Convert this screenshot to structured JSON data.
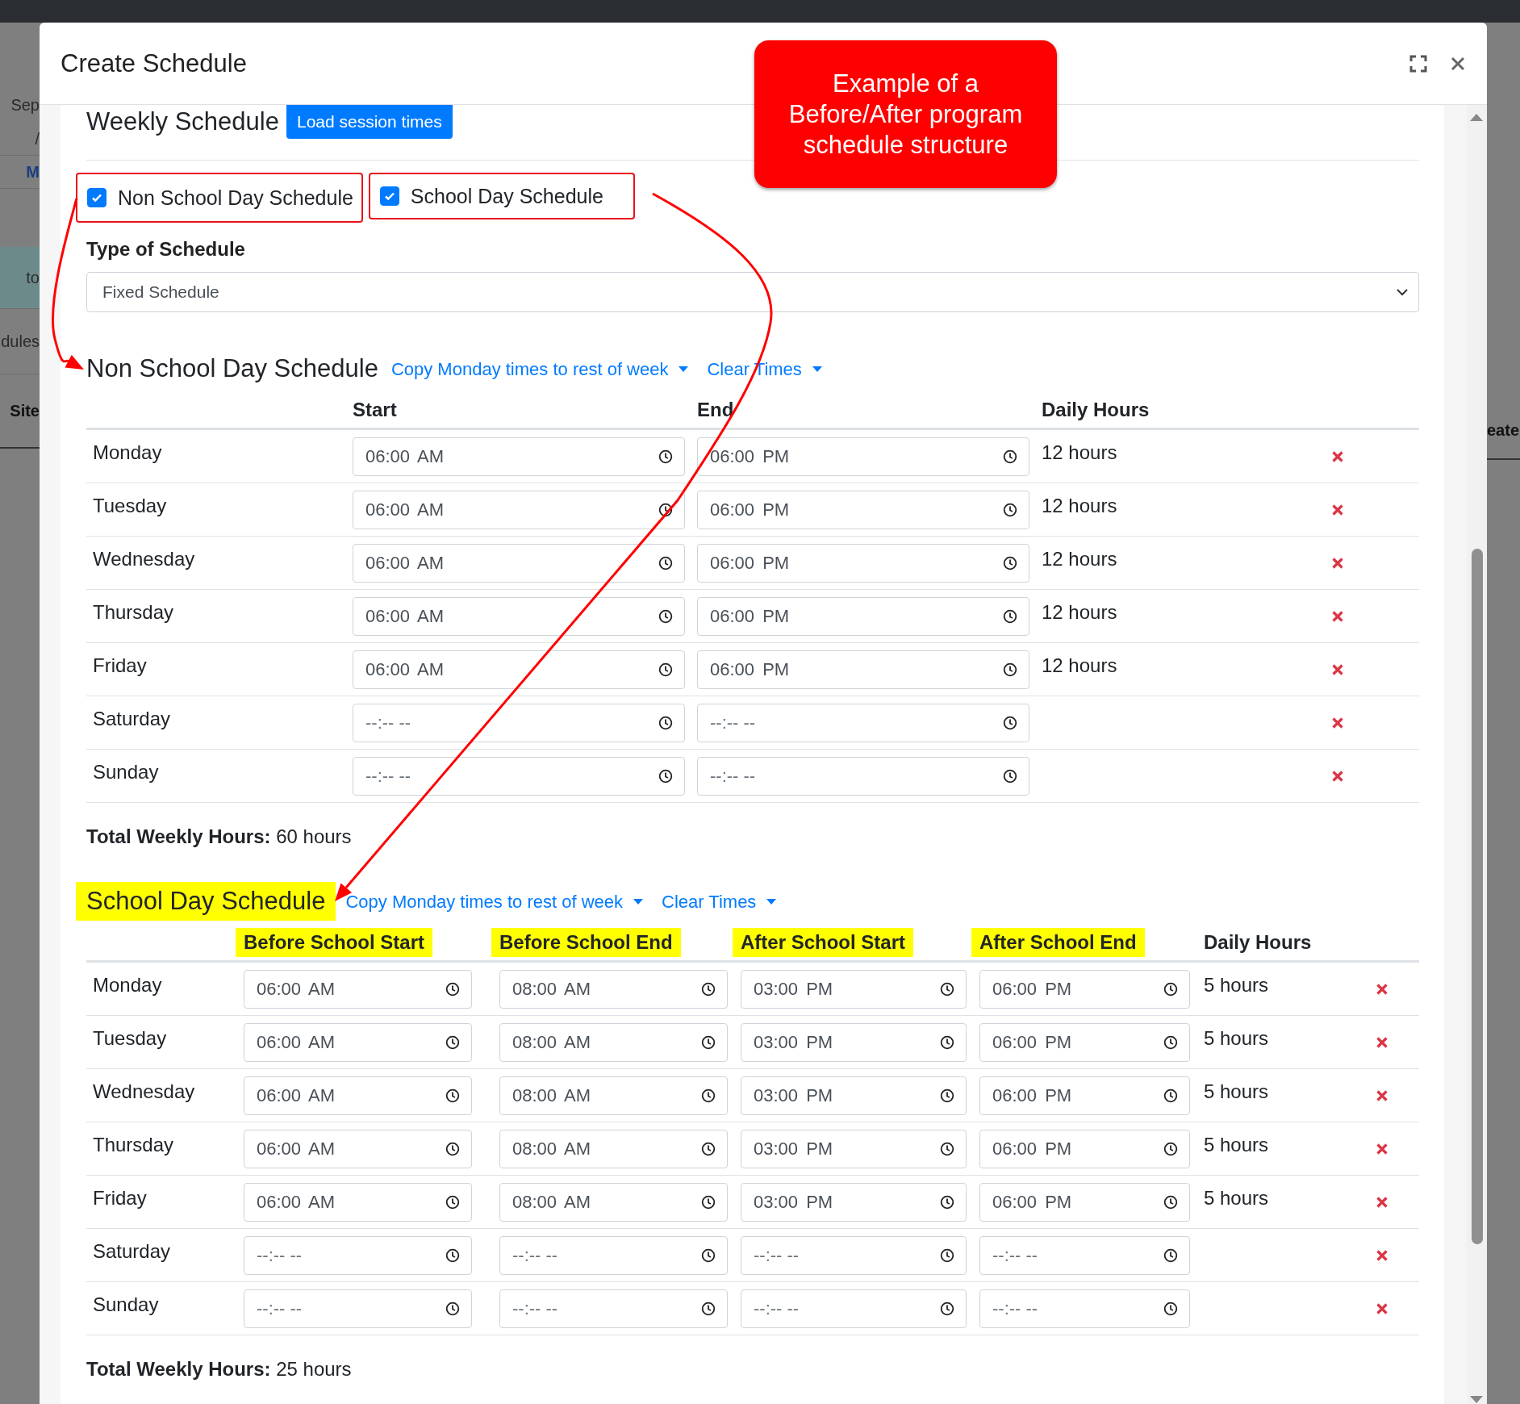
{
  "backdrop": {
    "left_texts": [
      {
        "text": "Sep",
        "kind": "plain"
      },
      {
        "text": "/",
        "kind": "plain"
      },
      {
        "text": "M",
        "kind": "link"
      },
      {
        "text": "to",
        "kind": "banner"
      },
      {
        "text": "dules",
        "kind": "plain"
      },
      {
        "text": "Site",
        "kind": "bold"
      }
    ],
    "right_texts": [
      {
        "text": "eate",
        "kind": "bold"
      }
    ]
  },
  "modal": {
    "title": "Create Schedule"
  },
  "callout": {
    "lines": [
      "Example of a",
      "Before/After program",
      "schedule structure"
    ]
  },
  "weekly": {
    "heading": "Weekly Schedule",
    "button": "Load session times"
  },
  "options": [
    {
      "label": "Non School Day Schedule",
      "checked": true,
      "outlined": true
    },
    {
      "label": "School Day Schedule",
      "checked": true,
      "outlined": true
    }
  ],
  "type_of_schedule": {
    "label": "Type of Schedule",
    "value": "Fixed Schedule"
  },
  "sections": [
    {
      "kind": "non_school",
      "title": "Non School Day Schedule",
      "highlighted": false,
      "actions": [
        "Copy Monday times to rest of week",
        "Clear Times"
      ],
      "columns": [
        {
          "label": "Start",
          "highlighted": false
        },
        {
          "label": "End",
          "highlighted": false
        },
        {
          "label": "Daily Hours",
          "highlighted": false
        }
      ],
      "rows": [
        {
          "day": "Monday",
          "times": [
            {
              "value": "06:00 AM"
            },
            {
              "value": "06:00 PM"
            }
          ],
          "daily_hours": "12 hours"
        },
        {
          "day": "Tuesday",
          "times": [
            {
              "value": "06:00 AM"
            },
            {
              "value": "06:00 PM"
            }
          ],
          "daily_hours": "12 hours"
        },
        {
          "day": "Wednesday",
          "times": [
            {
              "value": "06:00 AM"
            },
            {
              "value": "06:00 PM"
            }
          ],
          "daily_hours": "12 hours"
        },
        {
          "day": "Thursday",
          "times": [
            {
              "value": "06:00 AM"
            },
            {
              "value": "06:00 PM"
            }
          ],
          "daily_hours": "12 hours"
        },
        {
          "day": "Friday",
          "times": [
            {
              "value": "06:00 AM"
            },
            {
              "value": "06:00 PM"
            }
          ],
          "daily_hours": "12 hours"
        },
        {
          "day": "Saturday",
          "times": [
            {
              "placeholder": "--:-- --"
            },
            {
              "placeholder": "--:-- --"
            }
          ]
        },
        {
          "day": "Sunday",
          "times": [
            {
              "placeholder": "--:-- --"
            },
            {
              "placeholder": "--:-- --"
            }
          ]
        }
      ],
      "total_label": "Total Weekly Hours:",
      "total_value": "60 hours"
    },
    {
      "kind": "school",
      "title": "School Day Schedule",
      "highlighted": true,
      "actions": [
        "Copy Monday times to rest of week",
        "Clear Times"
      ],
      "columns": [
        {
          "label": "Before School Start",
          "highlighted": true
        },
        {
          "label": "Before School End",
          "highlighted": true
        },
        {
          "label": "After School Start",
          "highlighted": true
        },
        {
          "label": "After School End",
          "highlighted": true
        },
        {
          "label": "Daily Hours",
          "highlighted": false
        }
      ],
      "rows": [
        {
          "day": "Monday",
          "times": [
            {
              "value": "06:00 AM"
            },
            {
              "value": "08:00 AM"
            },
            {
              "value": "03:00 PM"
            },
            {
              "value": "06:00 PM"
            }
          ],
          "daily_hours": "5 hours"
        },
        {
          "day": "Tuesday",
          "times": [
            {
              "value": "06:00 AM"
            },
            {
              "value": "08:00 AM"
            },
            {
              "value": "03:00 PM"
            },
            {
              "value": "06:00 PM"
            }
          ],
          "daily_hours": "5 hours"
        },
        {
          "day": "Wednesday",
          "times": [
            {
              "value": "06:00 AM"
            },
            {
              "value": "08:00 AM"
            },
            {
              "value": "03:00 PM"
            },
            {
              "value": "06:00 PM"
            }
          ],
          "daily_hours": "5 hours"
        },
        {
          "day": "Thursday",
          "times": [
            {
              "value": "06:00 AM"
            },
            {
              "value": "08:00 AM"
            },
            {
              "value": "03:00 PM"
            },
            {
              "value": "06:00 PM"
            }
          ],
          "daily_hours": "5 hours"
        },
        {
          "day": "Friday",
          "times": [
            {
              "value": "06:00 AM"
            },
            {
              "value": "08:00 AM"
            },
            {
              "value": "03:00 PM"
            },
            {
              "value": "06:00 PM"
            }
          ],
          "daily_hours": "5 hours"
        },
        {
          "day": "Saturday",
          "times": [
            {
              "placeholder": "--:-- --"
            },
            {
              "placeholder": "--:-- --"
            },
            {
              "placeholder": "--:-- --"
            },
            {
              "placeholder": "--:-- --"
            }
          ]
        },
        {
          "day": "Sunday",
          "times": [
            {
              "placeholder": "--:-- --"
            },
            {
              "placeholder": "--:-- --"
            },
            {
              "placeholder": "--:-- --"
            },
            {
              "placeholder": "--:-- --"
            }
          ]
        }
      ],
      "total_label": "Total Weekly Hours:",
      "total_value": "25 hours"
    }
  ]
}
